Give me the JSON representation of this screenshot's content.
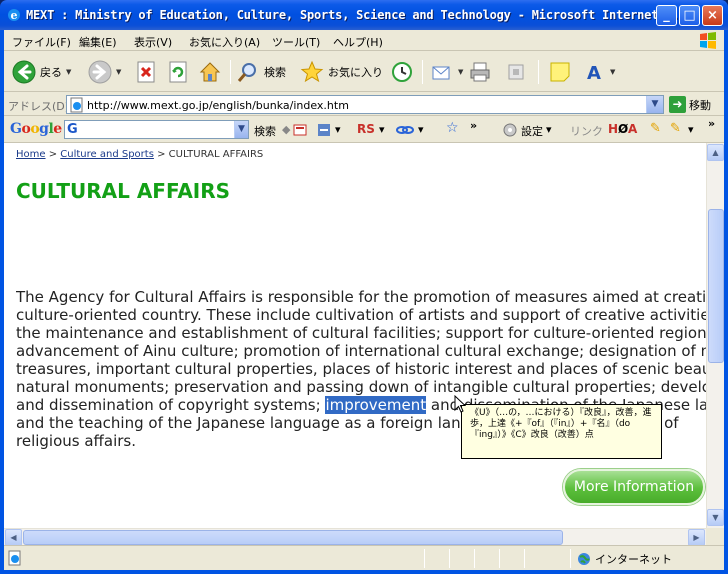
{
  "window": {
    "title": "MEXT : Ministry of Education, Culture, Sports, Science and Technology - Microsoft Internet...",
    "minimize": "_",
    "maximize": "□",
    "close": "×"
  },
  "menu": [
    "ファイル(F)",
    "編集(E)",
    "表示(V)",
    "お気に入り(A)",
    "ツール(T)",
    "ヘルプ(H)"
  ],
  "toolbar": {
    "back_label": "戻る",
    "search_label": "検索",
    "favorites_label": "お気に入り"
  },
  "address": {
    "label": "アドレス(D)",
    "url": "http://www.mext.go.jp/english/bunka/index.htm",
    "go_label": "移動"
  },
  "google": {
    "logo": "Google",
    "search_label": "検索",
    "rs_label": "RS",
    "settings_label": "設定",
    "links_label": "リンク"
  },
  "page": {
    "breadcrumb": {
      "home": "Home",
      "sep1": " > ",
      "culture": "Culture and Sports",
      "sep2": " > ",
      "current": "CULTURAL AFFAIRS"
    },
    "title": "CULTURAL AFFAIRS",
    "lines": [
      "The Agency for Cultural Affairs is responsible for the promotion of measures aimed at creating a",
      "culture-oriented country. These include cultivation of artists and support of creative activities;",
      "the maintenance and establishment of cultural facilities; support for culture-oriented regions;",
      "advancement of Ainu culture; promotion of international cultural exchange; designation of national",
      "treasures, important cultural properties, places of historic interest and places of scenic beauty and",
      "natural monuments; preservation and passing down of intangible cultural properties; development"
    ],
    "line7_before": "and dissemination of copyright systems; ",
    "line7_highlight": "improvement",
    "line7_after": " and dissemination of the Japanese language",
    "line8": "and the teaching of the Japanese language as a foreign language; and administration of",
    "line9": "religious affairs.",
    "more_button": "More Information"
  },
  "tooltip": {
    "text": "《U》（…の，…における）『改良』，改善，進歩，上達《+『of』（『in』）+『名』（do『ing』）》《C》改良（改善）点"
  },
  "status": {
    "zone_label": "インターネット"
  }
}
